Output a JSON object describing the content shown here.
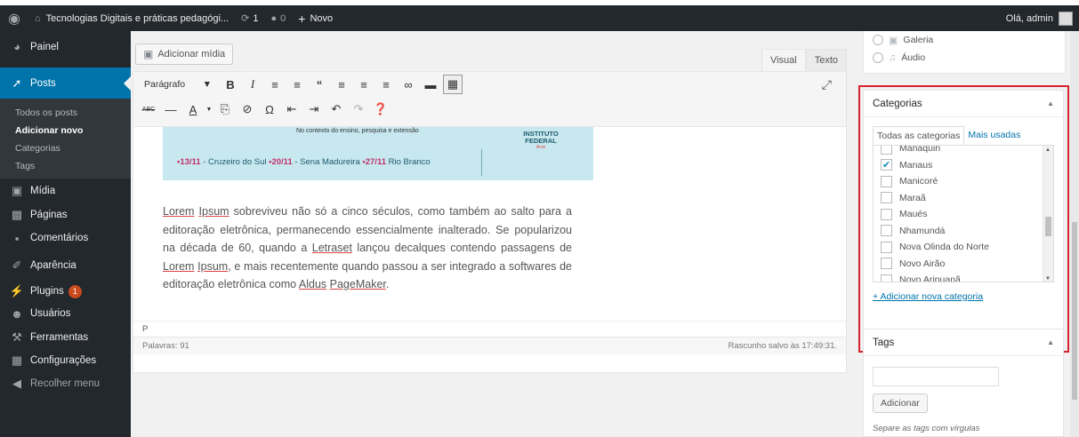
{
  "adminbar": {
    "site_title": "Tecnologias Digitais e práticas pedagógi...",
    "updates_count": "1",
    "comments_count": "0",
    "new_label": "Novo",
    "greeting": "Olá, admin"
  },
  "sidebar": {
    "items": [
      {
        "label": "Painel",
        "icon": "dashboard-icon"
      },
      {
        "label": "Posts",
        "icon": "pin-icon"
      },
      {
        "label": "Mídia",
        "icon": "media-icon"
      },
      {
        "label": "Páginas",
        "icon": "pages-icon"
      },
      {
        "label": "Comentários",
        "icon": "comments-icon"
      },
      {
        "label": "Aparência",
        "icon": "appearance-icon"
      },
      {
        "label": "Plugins",
        "icon": "plugins-icon",
        "badge": "1"
      },
      {
        "label": "Usuários",
        "icon": "users-icon"
      },
      {
        "label": "Ferramentas",
        "icon": "tools-icon"
      },
      {
        "label": "Configurações",
        "icon": "settings-icon"
      },
      {
        "label": "Recolher menu",
        "icon": "collapse-icon"
      }
    ],
    "submenu": [
      "Todos os posts",
      "Adicionar novo",
      "Categorias",
      "Tags"
    ]
  },
  "editor": {
    "add_media_label": "Adicionar mídia",
    "tab_visual": "Visual",
    "tab_text": "Texto",
    "format_select": "Parágrafo",
    "banner_top": "No contexto do ensino, pesquisa e extensão",
    "banner_dates": [
      {
        "date": "13/11",
        "place": " - Cruzeiro do Sul  "
      },
      {
        "date": "20/11",
        "place": " - Sena Madureira  "
      },
      {
        "date": "27/11",
        "place": " Rio Branco"
      }
    ],
    "banner_inst_1": "INSTITUTO",
    "banner_inst_2": "FEDERAL",
    "banner_inst_3": "Acre",
    "paragraph_parts": [
      "Lorem",
      " ",
      "Ipsum",
      " sobreviveu não só a cinco séculos, como também ao salto para a editoração eletrônica, permanecendo essencialmente inalterado. Se popularizou na década de 60, quando a ",
      "Letraset",
      " lançou decalques contendo passagens de ",
      "Lorem",
      " ",
      "Ipsum",
      ", e mais recentemente quando passou a ser integrado a softwares de editoração eletrônica como ",
      "Aldus",
      " ",
      "PageMaker",
      "."
    ],
    "path_label": "P",
    "word_count": "Palavras: 91",
    "draft_saved": "Rascunho salvo às 17:49:31."
  },
  "format_box": {
    "options": [
      {
        "label": "Galeria",
        "icon": "gallery-icon"
      },
      {
        "label": "Áudio",
        "icon": "audio-icon"
      }
    ]
  },
  "categories": {
    "title": "Categorias",
    "tab_all": "Todas as categorias",
    "tab_popular": "Mais usadas",
    "items": [
      {
        "label": "Manaquiri",
        "checked": false
      },
      {
        "label": "Manaus",
        "checked": true
      },
      {
        "label": "Manicoré",
        "checked": false
      },
      {
        "label": "Maraã",
        "checked": false
      },
      {
        "label": "Maués",
        "checked": false
      },
      {
        "label": "Nhamundá",
        "checked": false
      },
      {
        "label": "Nova Olinda do Norte",
        "checked": false
      },
      {
        "label": "Novo Airão",
        "checked": false
      },
      {
        "label": "Novo Aripuanã",
        "checked": false
      }
    ],
    "add_link": "+ Adicionar nova categoria"
  },
  "tags": {
    "title": "Tags",
    "add_button": "Adicionar",
    "hint": "Separe as tags com vírgulas"
  },
  "colors": {
    "accent": "#0073aa",
    "highlight_border": "#d6232f",
    "adminbar_bg": "#23282d"
  }
}
